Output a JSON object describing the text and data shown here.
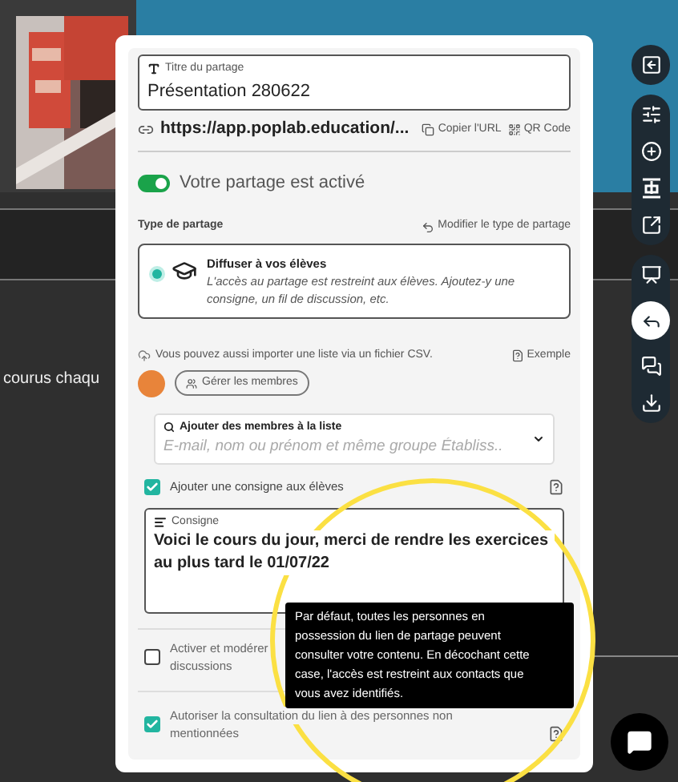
{
  "background": {
    "side_text": "courus chaqu"
  },
  "share_dialog": {
    "title_field": {
      "label": "Titre du partage",
      "value": "Présentation 280622"
    },
    "link": {
      "url": "https://app.poplab.education/...",
      "copy_label": "Copier l'URL",
      "qr_label": "QR Code"
    },
    "sharing_toggle": {
      "label": "Votre partage est activé",
      "on": true
    },
    "share_type": {
      "heading": "Type de partage",
      "change_label": "Modifier le type de partage",
      "option": {
        "title": "Diffuser à vos élèves",
        "description": "L'accès au partage est restreint aux élèves. Ajoutez-y une consigne, un fil de discussion, etc.",
        "selected": true
      }
    },
    "import_note": "Vous pouvez aussi importer une liste via un fichier CSV.",
    "example_link": "Exemple",
    "manage_members": "Gérer les membres",
    "add_members": {
      "label": "Ajouter des membres à la liste",
      "placeholder": "E-mail, nom ou prénom et même groupe Établiss.."
    },
    "instruction_option": {
      "label": "Ajouter une consigne aux élèves",
      "checked": true,
      "help": true
    },
    "instruction": {
      "label": "Consigne",
      "value": "Voici le cours du jour, merci de rendre les exercices au plus tard le 01/07/22"
    },
    "settings": [
      {
        "lines": [
          "Activer et modérer",
          "discussions"
        ],
        "checked": false
      },
      {
        "lines": [
          "Autoriser la consultation du lien à des personnes non",
          "mentionnées"
        ],
        "checked": true,
        "help": true
      }
    ],
    "tooltip": "Par défaut, toutes les personnes en possession du lien de partage peuvent consulter votre contenu. En décochant cette case, l'accès est restreint aux contacts que vous avez identifiés."
  }
}
